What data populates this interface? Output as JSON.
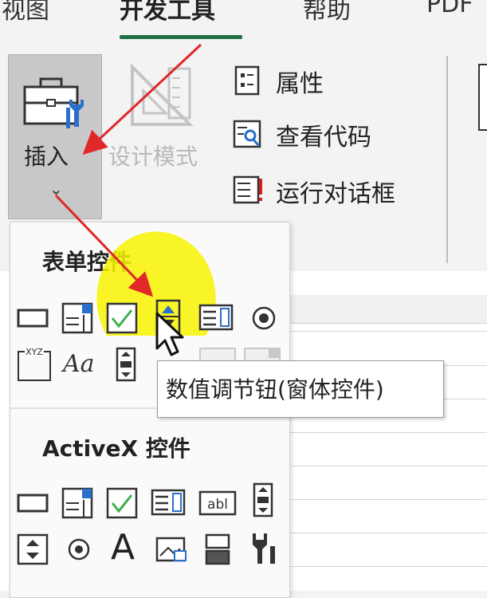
{
  "tabs": [
    {
      "label": "视图"
    },
    {
      "label": "开发工具",
      "active": true
    },
    {
      "label": "帮助"
    },
    {
      "label": "PDF"
    }
  ],
  "ribbon": {
    "insert_label": "插入",
    "design_mode_label": "设计模式",
    "properties_label": "属性",
    "view_code_label": "查看代码",
    "run_dialog_label": "运行对话框"
  },
  "dropdown": {
    "form_controls_title": "表单控件",
    "activex_title": "ActiveX 控件",
    "aa_glyph": "Aa",
    "big_a_glyph": "A",
    "abl_glyph": "abl",
    "xyz_glyph": "XYZ"
  },
  "tooltip": {
    "text": "数值调节钮(窗体控件)"
  },
  "colors": {
    "accent_green": "#1e7145",
    "highlight_yellow": "#f7f200",
    "arrow_red": "#e0282a",
    "checkbox_green": "#3cb04a"
  }
}
